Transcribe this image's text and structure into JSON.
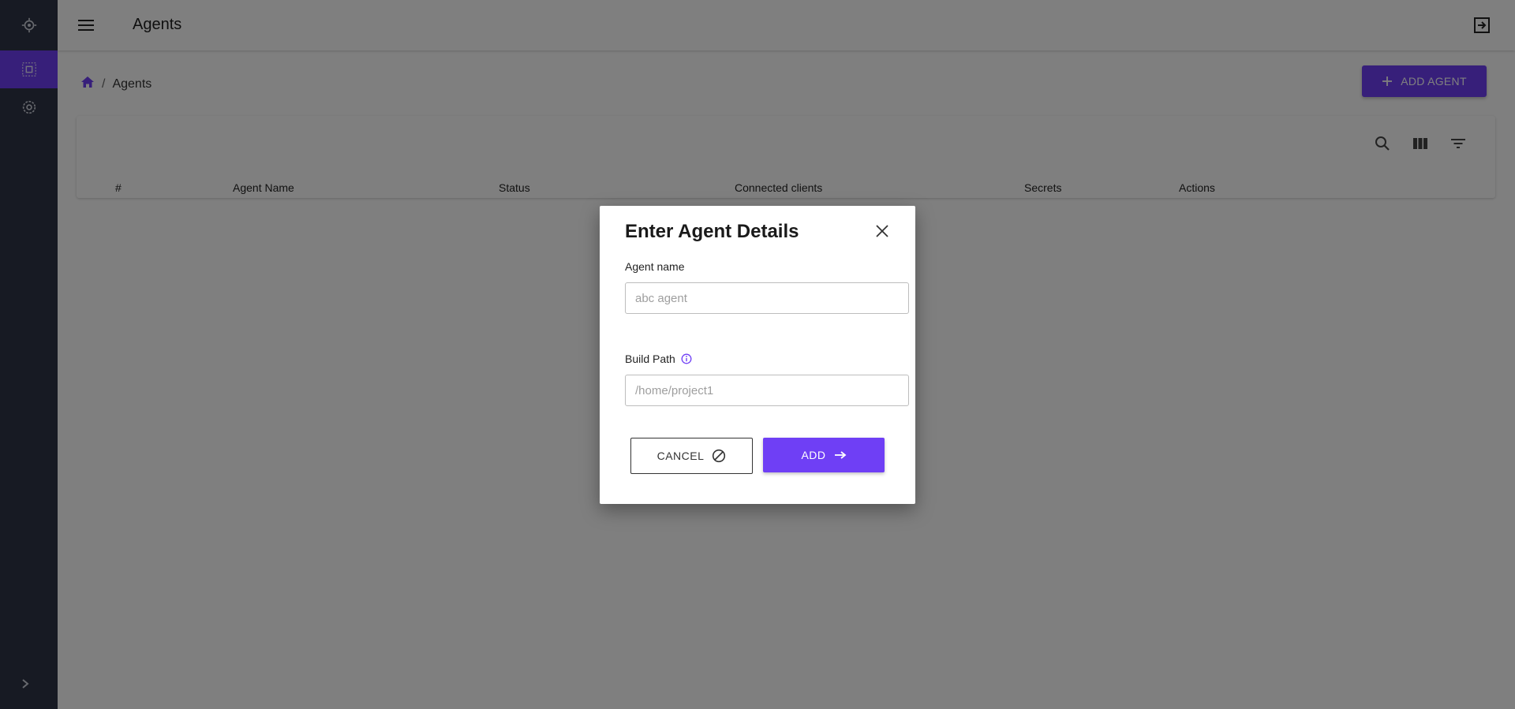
{
  "colors": {
    "sidebar": "#2f3447",
    "accent": "#6f3ff5",
    "overlay": "rgba(0,0,0,0.5)"
  },
  "sidebar": {
    "items": [
      {
        "icon": "bug-icon"
      },
      {
        "icon": "agents-icon",
        "active": true
      },
      {
        "icon": "gear-icon"
      }
    ],
    "expand_icon": "chevron-right-icon"
  },
  "header": {
    "title": "Agents",
    "menu_icon": "hamburger-icon",
    "logout_icon": "logout-icon"
  },
  "breadcrumb": {
    "home_icon": "home-icon",
    "separator": "/",
    "current": "Agents"
  },
  "toolbar": {
    "add_agent_label": "ADD AGENT",
    "icons": [
      "search-icon",
      "columns-icon",
      "filter-icon"
    ]
  },
  "table": {
    "columns": [
      "#",
      "Agent Name",
      "Status",
      "Connected clients",
      "Secrets",
      "Actions"
    ]
  },
  "dialog": {
    "title": "Enter Agent Details",
    "agent_name_label": "Agent name",
    "agent_name_placeholder": "abc agent",
    "agent_name_value": "",
    "build_path_label": "Build Path",
    "build_path_placeholder": "/home/project1",
    "build_path_value": "",
    "cancel_label": "CANCEL",
    "add_label": "ADD"
  }
}
